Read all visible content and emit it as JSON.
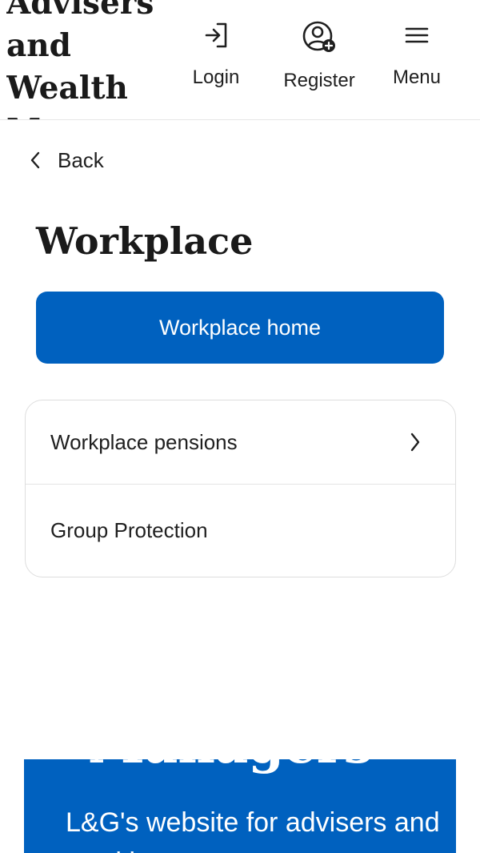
{
  "header": {
    "brand_lines": [
      "Advisers",
      "and",
      "Wealth",
      "Managers"
    ],
    "login": {
      "label": "Login",
      "icon": "login-arrow-icon"
    },
    "register": {
      "label": "Register",
      "icon": "user-add-icon"
    },
    "menu": {
      "label": "Menu",
      "icon": "hamburger-menu-icon"
    }
  },
  "nav": {
    "back_label": "Back",
    "back_icon": "chevron-left-icon"
  },
  "page": {
    "title": "Workplace"
  },
  "primary_button": {
    "label": "Workplace home"
  },
  "list": {
    "items": [
      {
        "label": "Workplace pensions",
        "has_submenu": true
      },
      {
        "label": "Group Protection",
        "has_submenu": false
      }
    ]
  },
  "footer": {
    "clipped_heading": "Managers",
    "text": "L&G's website for advisers and wealth managers"
  },
  "colors": {
    "primary": "#0061bf",
    "text": "#1f1f1f",
    "border": "#dedede",
    "background": "#ffffff"
  }
}
